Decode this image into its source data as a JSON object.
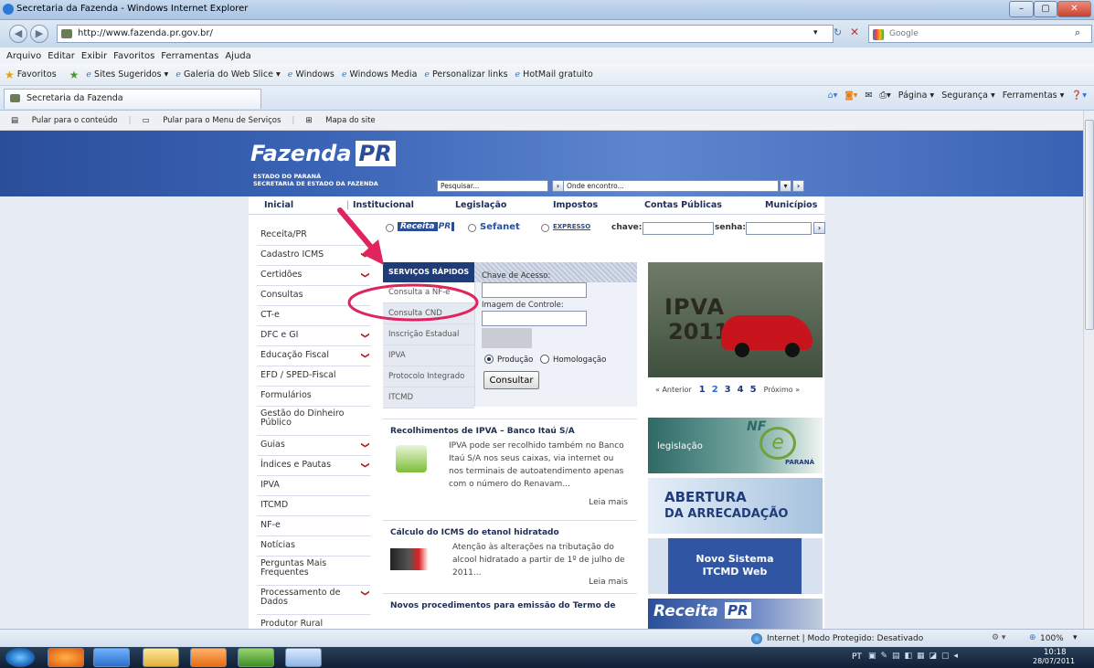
{
  "window": {
    "title": "Secretaria da Fazenda - Windows Internet Explorer",
    "min": "–",
    "max": "▢",
    "close": "✕"
  },
  "address": {
    "url": "http://www.fazenda.pr.gov.br/",
    "search_placeholder": "Google"
  },
  "menu": [
    "Arquivo",
    "Editar",
    "Exibir",
    "Favoritos",
    "Ferramentas",
    "Ajuda"
  ],
  "favbar": {
    "favorites": "Favoritos",
    "links": [
      "Sites Sugeridos ▾",
      "Galeria do Web Slice ▾",
      "Windows",
      "Windows Media",
      "Personalizar links",
      "HotMail gratuito"
    ]
  },
  "tab": {
    "title": "Secretaria da Fazenda"
  },
  "commands": [
    "Página ▾",
    "Segurança ▾",
    "Ferramentas ▾"
  ],
  "skiplinks": [
    "Pular para o conteúdo",
    "Pular para o Menu de Serviços",
    "Mapa do site"
  ],
  "header": {
    "logo_main": "Fazenda",
    "logo_pr": "PR",
    "tag1": "ESTADO DO PARANÁ",
    "tag2": "SECRETARIA DE ESTADO DA FAZENDA",
    "search_value": "Pesquisar...",
    "onde_value": "Onde encontro...",
    "go": "›"
  },
  "topnav": [
    "Inicial",
    "Institucional",
    "Legislação",
    "Impostos",
    "Contas Públicas",
    "Municípios"
  ],
  "leftnav": [
    {
      "label": "Receita/PR",
      "chev": ""
    },
    {
      "label": "Cadastro ICMS",
      "chev": "❯"
    },
    {
      "label": "Certidões",
      "chev": "❯"
    },
    {
      "label": "Consultas",
      "chev": ""
    },
    {
      "label": "CT-e",
      "chev": ""
    },
    {
      "label": "DFC e GI",
      "chev": "❯"
    },
    {
      "label": "Educação Fiscal",
      "chev": "❯"
    },
    {
      "label": "EFD / SPED-Fiscal",
      "chev": ""
    },
    {
      "label": "Formulários",
      "chev": ""
    },
    {
      "label": "Gestão do Dinheiro Público",
      "chev": ""
    },
    {
      "label": "Guias",
      "chev": "❯"
    },
    {
      "label": "Índices e Pautas",
      "chev": "❯"
    },
    {
      "label": "IPVA",
      "chev": ""
    },
    {
      "label": "ITCMD",
      "chev": ""
    },
    {
      "label": "NF-e",
      "chev": ""
    },
    {
      "label": "Notícias",
      "chev": ""
    },
    {
      "label": "Perguntas Mais Frequentes",
      "chev": ""
    },
    {
      "label": "Processamento de Dados",
      "chev": "❯"
    },
    {
      "label": "Produtor Rural",
      "chev": ""
    }
  ],
  "login": {
    "opt1": "Receita",
    "opt1b": "PR",
    "opt2": "Sefanet",
    "opt3": "EXPRESSO",
    "chave": "chave:",
    "senha": "senha:"
  },
  "quick": {
    "title": "SERVIÇOS RÁPIDOS",
    "items": [
      "Consulta a NF-e",
      "Consulta CND",
      "Inscrição Estadual",
      "IPVA",
      "Protocolo Integrado",
      "ITCMD"
    ],
    "access_label": "Chave de Acesso:",
    "image_label": "Imagem de Controle:",
    "prod": "Produção",
    "homo": "Homologação",
    "submit": "Consultar"
  },
  "news": [
    {
      "title": "Recolhimentos de IPVA – Banco Itaú S/A",
      "body": "IPVA pode ser recolhido também no Banco Itaú S/A nos seus caixas, via internet ou nos terminais de autoatendimento apenas com o número do Renavam...",
      "more": "Leia mais"
    },
    {
      "title": "Cálculo do ICMS do etanol hidratado",
      "body": "Atenção às alterações na tributação do alcool hidratado a partir de 1º de julho de 2011...",
      "more": "Leia mais"
    },
    {
      "title": "Novos procedimentos para emissão do Termo de",
      "body": "",
      "more": ""
    }
  ],
  "ipva": {
    "line1": "IPVA",
    "line2": "2011",
    "prev": "« Anterior",
    "pages": [
      "1",
      "2",
      "3",
      "4",
      "5"
    ],
    "next": "Próximo »"
  },
  "nfe": {
    "legis": "legislação",
    "nf": "NF",
    "e": "e",
    "parana": "PARANÁ"
  },
  "abertura": {
    "l1": "ABERTURA",
    "l2": "DA ARRECADAÇÃO"
  },
  "itcmd": {
    "l1": "Novo Sistema",
    "l2": "ITCMD Web"
  },
  "receita": {
    "main": "Receita",
    "pr": "PR"
  },
  "status": {
    "zone": "Internet | Modo Protegido: Desativado",
    "zoom": "100%"
  },
  "tray": {
    "lang": "PT",
    "time": "10:18",
    "date": "28/07/2011"
  },
  "colors": {
    "brand": "#2a4e9a",
    "annotation": "#e0245e"
  }
}
